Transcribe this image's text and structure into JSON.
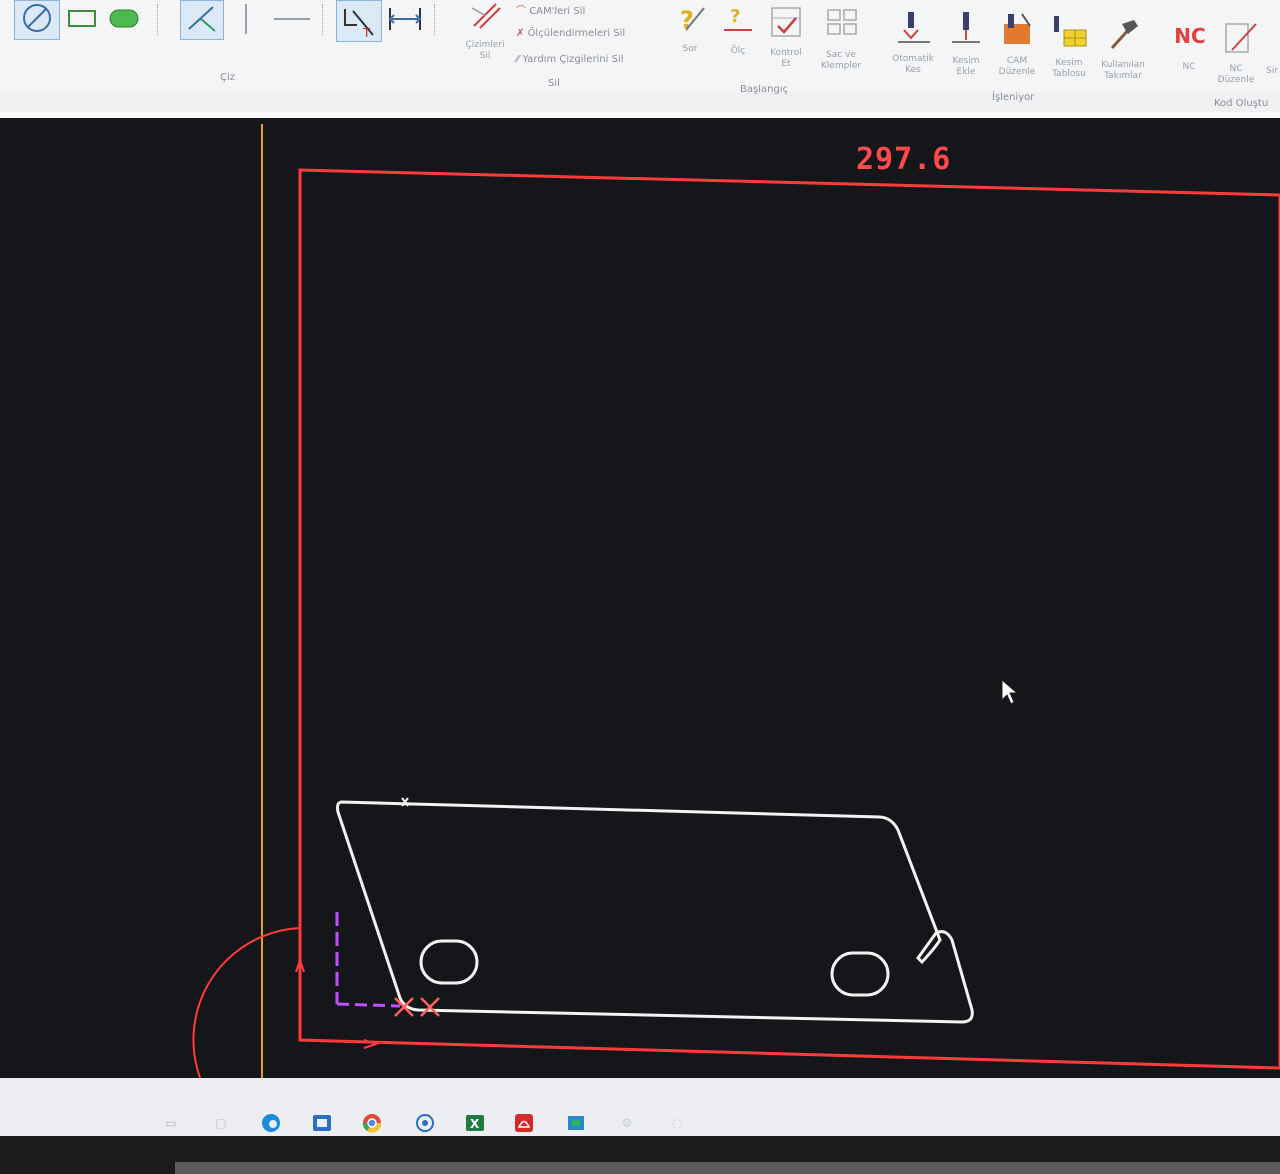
{
  "ribbon": {
    "groups": {
      "draw": "Çiz",
      "delete": "Sil",
      "start": "Başlangıç",
      "process": "İşleniyor",
      "code": "Kod Oluştu"
    },
    "delete": {
      "drawings_label": "Çizimleri\nSil",
      "cam_label": "CAM'leri Sil",
      "dims_label": "Ölçülendirmeleri Sil",
      "guides_label": "Yardım Çizgilerini Sil"
    },
    "start": {
      "ask_label": "Sor",
      "measure_label": "Ölç",
      "check_label": "Kontrol\nEt",
      "sheets_label": "Sac ve\nKlempler"
    },
    "process": {
      "auto_cut_label": "Otomatik\nKes",
      "add_cut_label": "Kesim\nEkle",
      "cam_edit_label": "CAM\nDüzenle",
      "cut_table_label": "Kesim\nTablosu",
      "tools_label": "Kullanılan\nTakımlar"
    },
    "code": {
      "nc_icon_text": "NC",
      "nc_label": "NC",
      "nc_edit_label": "NC\nDüzenle",
      "extra_label": "Sir"
    }
  },
  "canvas": {
    "dimension_text": "297.6"
  },
  "colors": {
    "sheet_border": "#ff3b3b",
    "part_outline": "#f2f2f2",
    "origin_axis": "#c050ff",
    "yellow_line": "#e0a030"
  },
  "taskbar": {
    "icons": [
      "file-explorer-icon",
      "edge-icon",
      "store-icon",
      "chrome-icon",
      "support-icon",
      "excel-icon",
      "pdf-icon",
      "app-icon",
      "settings-icon"
    ]
  }
}
